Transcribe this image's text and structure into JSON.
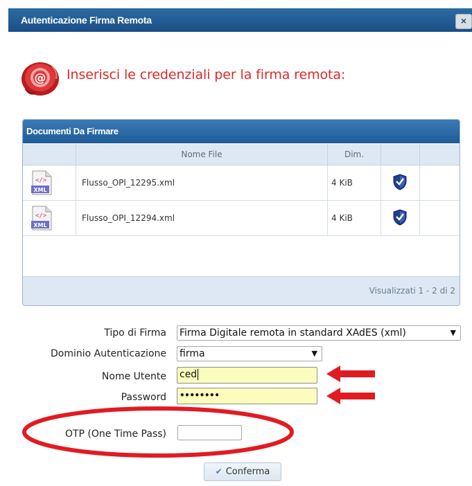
{
  "dialog": {
    "title": "Autenticazione Firma Remota",
    "close_label": "×"
  },
  "heading": {
    "text": "Inserisci le credenziali per la firma remota:",
    "icon": "at-seal-icon"
  },
  "documents": {
    "caption": "Documenti Da Firmare",
    "columns": [
      "",
      "Nome File",
      "Dim.",
      "",
      ""
    ],
    "rows": [
      {
        "icon": "xml-file-icon",
        "icon_text": "XML",
        "name": "Flusso_OPI_12295.xml",
        "size": "4 KiB",
        "status_icon": "shield-check-icon"
      },
      {
        "icon": "xml-file-icon",
        "icon_text": "XML",
        "name": "Flusso_OPI_12294.xml",
        "size": "4 KiB",
        "status_icon": "shield-check-icon"
      }
    ],
    "footer": "Visualizzati 1 - 2 di 2"
  },
  "form": {
    "tipo_firma": {
      "label": "Tipo di Firma",
      "value": "Firma Digitale remota in standard XAdES (xml)"
    },
    "dominio": {
      "label": "Dominio Autenticazione",
      "value": "firma"
    },
    "utente": {
      "label": "Nome Utente",
      "value": "ced"
    },
    "password": {
      "label": "Password",
      "value": "••••••••"
    },
    "otp": {
      "label": "OTP (One Time Pass)",
      "value": ""
    }
  },
  "confirm_button": {
    "label": "Conferma",
    "icon": "check-icon"
  },
  "colors": {
    "title_bar": "#1f5c97",
    "heading": "#e0282a",
    "annotation_red": "#e11b22",
    "field_highlight": "#fcfcbc"
  }
}
